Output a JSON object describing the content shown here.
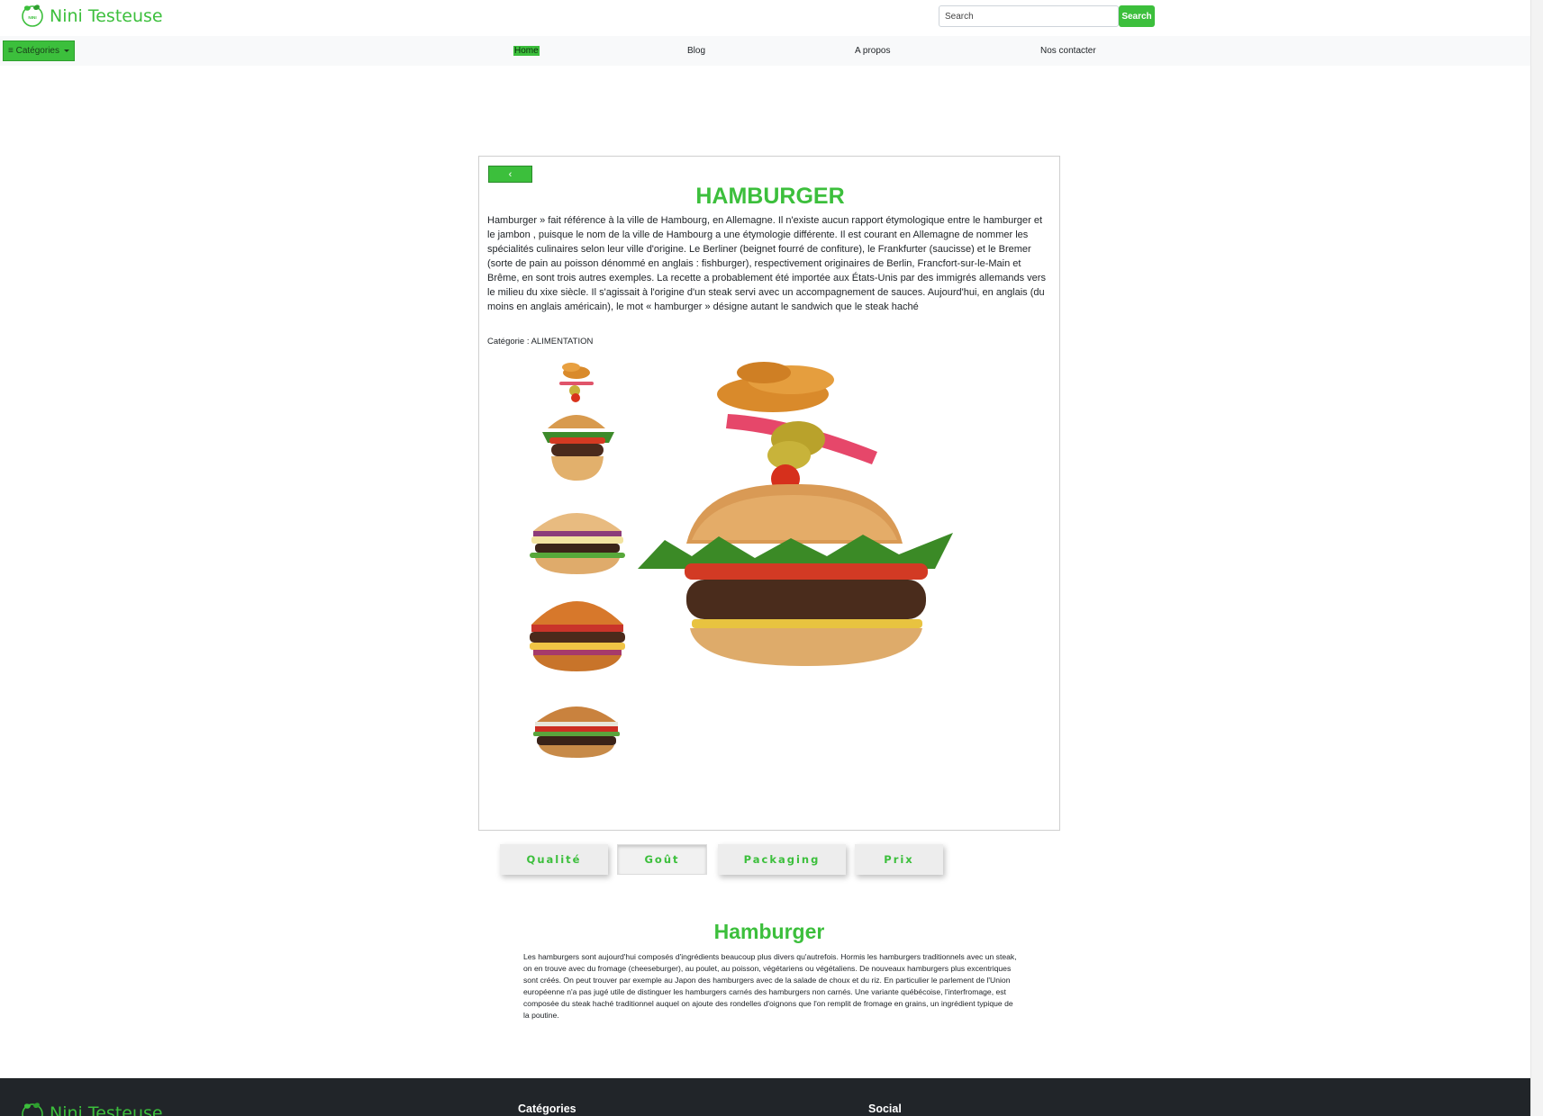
{
  "header": {
    "brand": "Nini Testeuse",
    "logo_text": "NINI",
    "search_placeholder": "Search",
    "search_button": "Search"
  },
  "nav": {
    "categories_label": "≡ Catégories",
    "links": [
      "Home",
      "Blog",
      "A propos",
      "Nos contacter"
    ]
  },
  "product": {
    "back_label": "‹",
    "title": "HAMBURGER",
    "description": "Hamburger » fait référence à la ville de Hambourg, en Allemagne. Il n'existe aucun rapport étymologique entre le hamburger et le jambon , puisque le nom de la ville de Hambourg a une étymologie différente. Il est courant en Allemagne de nommer les spécialités culinaires selon leur ville d'origine. Le Berliner (beignet fourré de confiture), le Frankfurter (saucisse) et le Bremer (sorte de pain au poisson dénommé en anglais : fishburger), respectivement originaires de Berlin, Francfort-sur-le-Main et Brême, en sont trois autres exemples. La recette a probablement été importée aux États-Unis par des immigrés allemands vers le milieu du xixe siècle. Il s'agissait à l'origine d'un steak servi avec un accompagnement de sauces. Aujourd'hui, en anglais (du moins en anglais américain), le mot « hamburger » désigne autant le sandwich que le steak haché",
    "category": "Catégorie : ALIMENTATION"
  },
  "tabs": [
    "Qualité",
    "Goût",
    "Packaging",
    "Prix"
  ],
  "section": {
    "title": "Hamburger",
    "text": "Les hamburgers sont aujourd'hui composés d'ingrédients beaucoup plus divers qu'autrefois. Hormis les hamburgers traditionnels avec un steak, on en trouve avec du fromage (cheeseburger), au poulet, au poisson, végétariens ou végétaliens. De nouveaux hamburgers plus excentriques sont créés. On peut trouver par exemple au Japon des hamburgers avec de la salade de choux et du riz. En particulier le parlement de l'Union européenne n'a pas jugé utile de distinguer les hamburgers carnés des hamburgers non carnés. Une variante québécoise, l'interfromage, est composée du steak haché traditionnel auquel on ajoute des rondelles d'oignons que l'on remplit de fromage en grains, un ingrédient typique de la poutine."
  },
  "footer": {
    "brand": "Nini Testeuse",
    "col1": "Catégories",
    "col2": "Social"
  },
  "colors": {
    "accent": "#3cbf3c",
    "footer_bg": "#212529",
    "nav_bg": "#f8f9fa"
  },
  "icons": {
    "logo": "leaf-logo-icon",
    "back": "chevron-left-icon",
    "menu": "hamburger-menu-icon"
  }
}
